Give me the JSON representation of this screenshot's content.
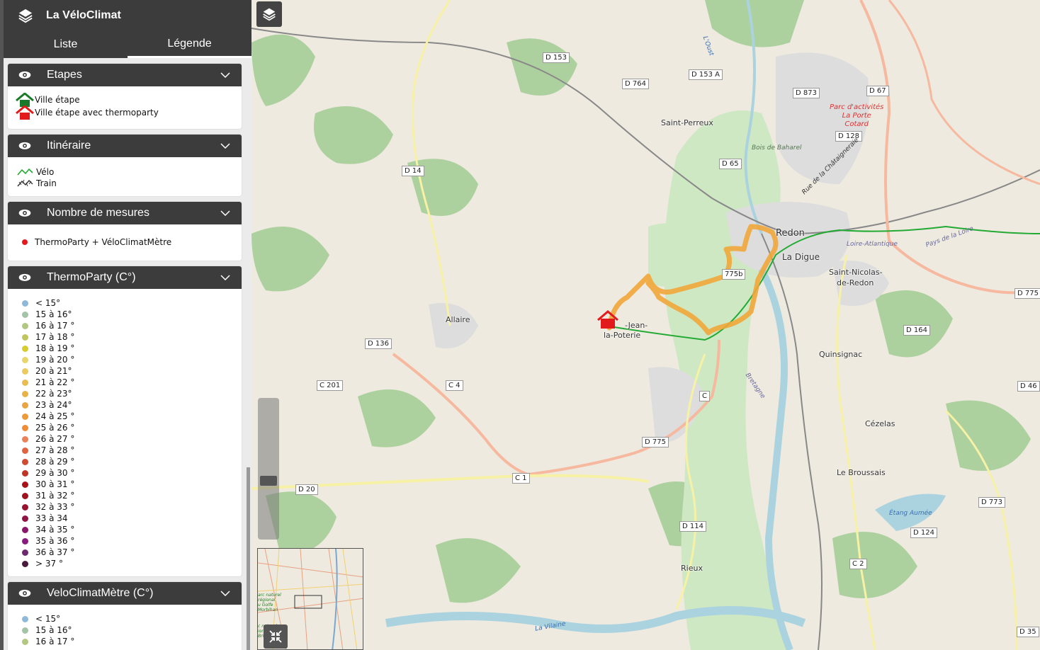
{
  "app": {
    "title": "La VéloClimat"
  },
  "tabs": [
    {
      "label": "Liste"
    },
    {
      "label": "Légende"
    }
  ],
  "legend": {
    "etapes": {
      "title": "Etapes",
      "items": [
        {
          "label": "Ville étape"
        },
        {
          "label": "Ville étape avec thermoparty"
        }
      ]
    },
    "itineraire": {
      "title": "Itinéraire",
      "items": [
        {
          "label": "Vélo"
        },
        {
          "label": "Train"
        }
      ]
    },
    "mesures": {
      "title": "Nombre de mesures",
      "items": [
        {
          "label": "ThermoParty + VéloClimatMètre",
          "color": "#e31a1c"
        }
      ]
    },
    "thermoparty": {
      "title": "ThermoParty (C°)",
      "items": [
        {
          "label": "< 15°",
          "color": "#8fb9d8"
        },
        {
          "label": "15 à 16°",
          "color": "#a3c4a6"
        },
        {
          "label": "16 à 17 °",
          "color": "#b2c77f"
        },
        {
          "label": "17 à 18 °",
          "color": "#c0c65c"
        },
        {
          "label": "18 à 19 °",
          "color": "#d9cc2e"
        },
        {
          "label": "19 à 20 °",
          "color": "#ead56a"
        },
        {
          "label": "20 à 21°",
          "color": "#ebcb60"
        },
        {
          "label": "21 à 22 °",
          "color": "#eabd52"
        },
        {
          "label": "22 à 23°",
          "color": "#e9b249"
        },
        {
          "label": "23 à 24°",
          "color": "#eaa441"
        },
        {
          "label": "24 à 25 °",
          "color": "#ee9a3a"
        },
        {
          "label": "25 à 26 °",
          "color": "#f08c35"
        },
        {
          "label": "26 à 27 °",
          "color": "#ec8257"
        },
        {
          "label": "27 à 28 °",
          "color": "#e0643f"
        },
        {
          "label": "28 à 29 °",
          "color": "#d04b32"
        },
        {
          "label": "29 à 30 °",
          "color": "#bf3526"
        },
        {
          "label": "30 à 31 °",
          "color": "#a8141a"
        },
        {
          "label": "31 à 32 °",
          "color": "#a0121e"
        },
        {
          "label": "32 à 33 °",
          "color": "#981330"
        },
        {
          "label": "33 à 34",
          "color": "#901444"
        },
        {
          "label": "34 à 35 °",
          "color": "#8c156a"
        },
        {
          "label": "35 à 36 °",
          "color": "#8a1a80"
        },
        {
          "label": "36 à 37 °",
          "color": "#6e2a6e"
        },
        {
          "label": "> 37 °",
          "color": "#4a1a3c"
        }
      ]
    },
    "veloclimat": {
      "title": "VeloClimatMètre (C°)",
      "items": [
        {
          "label": "< 15°",
          "color": "#8fb9d8"
        },
        {
          "label": "15 à 16°",
          "color": "#a3c4a6"
        },
        {
          "label": "16 à 17 °",
          "color": "#b2c77f"
        }
      ]
    }
  },
  "map": {
    "places": [
      {
        "name": "Saint-Perreux"
      },
      {
        "name": "Redon"
      },
      {
        "name": "La Digue"
      },
      {
        "name": "Saint-Nicolas-"
      },
      {
        "name": "de-Redon"
      },
      {
        "name": "Allaire"
      },
      {
        "name": "Quinsignac"
      },
      {
        "name": "Cézelas"
      },
      {
        "name": "Le Broussais"
      },
      {
        "name": "Rieux"
      },
      {
        "name": "-Jean-"
      },
      {
        "name": "la-Poterie"
      }
    ],
    "roads": [
      "D 153",
      "D 764",
      "D 153 A",
      "D 873",
      "D 67",
      "D 128",
      "D 14",
      "D 65",
      "D 136",
      "C 201",
      "C 4",
      "D 775",
      "C 1",
      "D 20",
      "D 114",
      "D 164",
      "D 775",
      "D 46",
      "D 773",
      "D 124",
      "C 2",
      "D 35",
      "775b",
      "C"
    ],
    "poi": {
      "line1": "Parc d'activités",
      "line2": "La Porte",
      "line3": "Cotard"
    },
    "water": [
      "Bois de Baharel",
      "Rue de la Châtaigneraie",
      "Loire-Atlantique",
      "Pays de la Loire",
      "Bretagne",
      "Étang Aumée",
      "La Vilaine",
      "L'Oust"
    ],
    "route_color": "#f0a63a",
    "minimap": {
      "label1": "arc naturel",
      "label2": "régional",
      "label3": "u Golfe",
      "label4": "Morbihan",
      "label5": "c naturel",
      "label6": "ional",
      "label7": "Brière"
    }
  }
}
